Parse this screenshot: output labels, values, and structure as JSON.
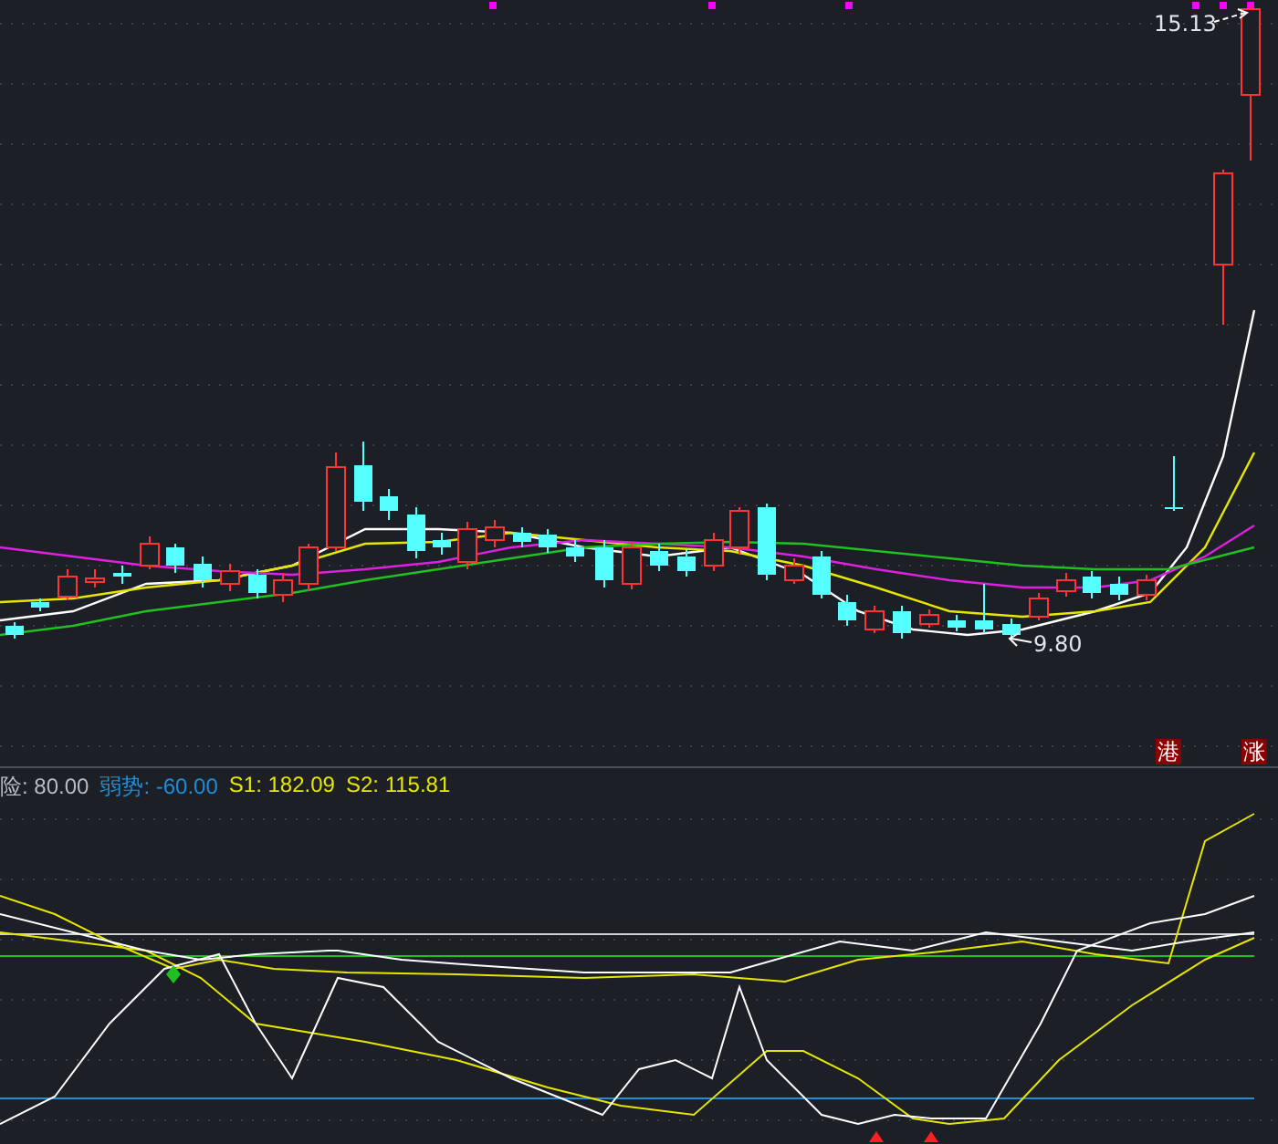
{
  "price_chart": {
    "high_label": "15.13",
    "low_label": "9.80",
    "tags": [
      "港",
      "涨"
    ]
  },
  "indicator": {
    "legend": [
      {
        "label": "险: 80.00",
        "color": "#b8bcc4"
      },
      {
        "label": "弱势: -60.00",
        "color": "#1e8fd6"
      },
      {
        "label": "S1: 182.09",
        "color": "#e6e600"
      },
      {
        "label": "S2: 115.81",
        "color": "#e6e600"
      }
    ]
  }
}
